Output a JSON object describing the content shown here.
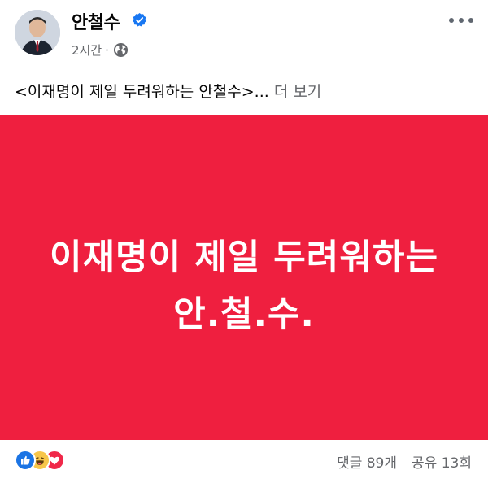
{
  "post": {
    "author_name": "안철수",
    "time": "2시간",
    "separator": "·",
    "text": "<이재명이 제일 두려워하는 안철수>...",
    "see_more": "더 보기"
  },
  "banner": {
    "line1": "이재명이 제일 두려워하는",
    "line2": "안.철.수.",
    "color": "#ef1f3f"
  },
  "footer": {
    "reactions": [
      "like-icon",
      "haha-icon",
      "love-icon"
    ],
    "comments": "댓글 89개",
    "shares": "공유 13회"
  },
  "colors": {
    "text": "#050505",
    "secondary": "#65676b",
    "verified": "#1877f2"
  }
}
